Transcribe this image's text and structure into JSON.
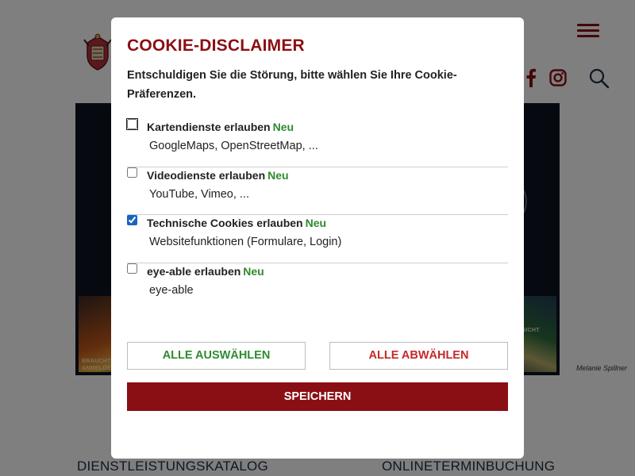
{
  "background": {
    "credit": "Melanie Spillner",
    "hero_tile_left_text": "BRAUCHT\nANMELDE",
    "hero_tile_right_text": "ERSICHT",
    "bottom_links": [
      "DIENSTLEISTUNGSKATALOG",
      "ONLINETERMINBUCHUNG"
    ],
    "icons": [
      "crest-logo-icon",
      "hamburger-menu-icon",
      "facebook-icon",
      "instagram-icon",
      "search-icon"
    ]
  },
  "modal": {
    "title": "COOKIE-DISCLAIMER",
    "intro": "Entschuldigen Sie die Störung, bitte wählen Sie Ihre Cookie-Präferenzen.",
    "options": [
      {
        "label": "Kartendienste erlauben",
        "badge": "Neu",
        "description": "GoogleMaps, OpenStreetMap, ...",
        "checked": false
      },
      {
        "label": "Videodienste erlauben",
        "badge": "Neu",
        "description": "YouTube, Vimeo, ...",
        "checked": false
      },
      {
        "label": "Technische Cookies erlauben",
        "badge": "Neu",
        "description": "Websitefunktionen (Formulare, Login)",
        "checked": true
      },
      {
        "label": "eye-able erlauben",
        "badge": "Neu",
        "description": "eye-able",
        "checked": false
      }
    ],
    "select_all_label": "ALLE AUSWÄHLEN",
    "deselect_all_label": "ALLE ABWÄHLEN",
    "save_label": "SPEICHERN"
  },
  "colors": {
    "brand_red": "#8a0f14",
    "new_badge_green": "#2e8b2e",
    "deselect_red": "#c62828",
    "checkbox_blue": "#1565c0"
  }
}
